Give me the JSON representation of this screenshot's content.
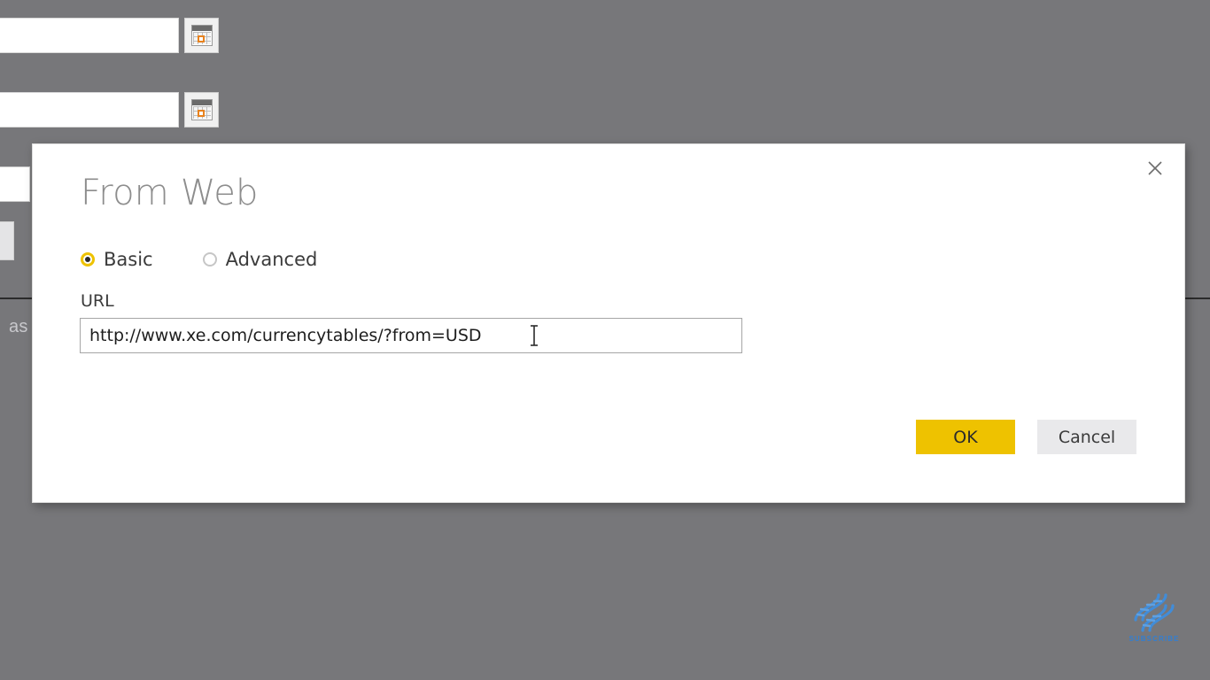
{
  "background": {
    "overlay_color": "#77777a",
    "date_fields": [
      {
        "name": "date-field-1",
        "value": "",
        "calendar_icon": "calendar-icon"
      },
      {
        "name": "date-field-2",
        "value": "",
        "calendar_icon": "calendar-icon"
      }
    ],
    "fragment_text": "as"
  },
  "dialog": {
    "title": "From Web",
    "close_icon": "close-icon",
    "mode": {
      "selected": "Basic",
      "options": [
        {
          "label": "Basic",
          "selected": true
        },
        {
          "label": "Advanced",
          "selected": false
        }
      ]
    },
    "url": {
      "label": "URL",
      "value": "http://www.xe.com/currencytables/?from=USD",
      "placeholder": "",
      "cursor_icon": "text-cursor-icon"
    },
    "buttons": {
      "ok": "OK",
      "cancel": "Cancel"
    },
    "accent_color": "#eec200"
  },
  "watermark": {
    "label": "SUBSCRIBE",
    "icon": "dna-helix-icon",
    "color": "#2f7fd6"
  }
}
